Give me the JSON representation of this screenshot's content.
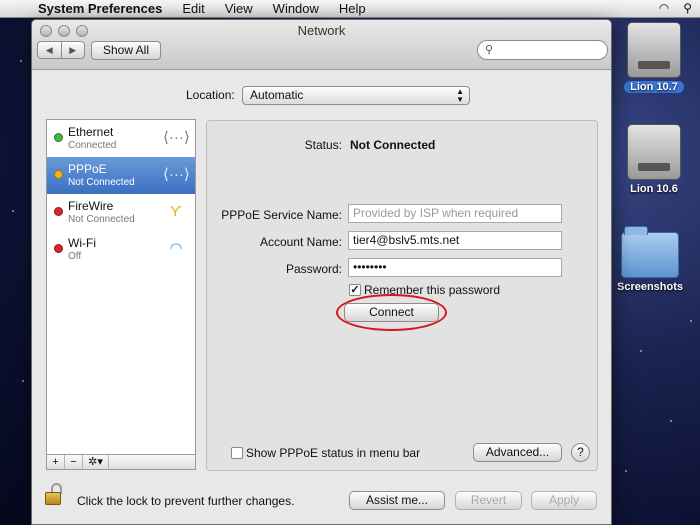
{
  "menubar": {
    "app_name": "System Preferences",
    "menus": [
      "Edit",
      "View",
      "Window",
      "Help"
    ]
  },
  "desktop": {
    "icons": [
      {
        "label": "Lion 10.7",
        "kind": "disk"
      },
      {
        "label": "Lion 10.6",
        "kind": "disk"
      },
      {
        "label": "Screenshots",
        "kind": "folder"
      }
    ]
  },
  "window": {
    "title": "Network",
    "show_all_label": "Show All",
    "search_placeholder": ""
  },
  "location": {
    "label": "Location:",
    "value": "Automatic"
  },
  "services": [
    {
      "name": "Ethernet",
      "status": "Connected",
      "dot_color": "#3fb83f",
      "icon": "ethernet-icon",
      "glyph": "⟨···⟩"
    },
    {
      "name": "PPPoE",
      "status": "Not Connected",
      "dot_color": "#f2b51c",
      "icon": "pppoe-icon",
      "glyph": "⟨···⟩"
    },
    {
      "name": "FireWire",
      "status": "Not Connected",
      "dot_color": "#d8262a",
      "icon": "firewire-icon",
      "glyph": "Ƴ"
    },
    {
      "name": "Wi-Fi",
      "status": "Off",
      "dot_color": "#d8262a",
      "icon": "wifi-icon",
      "glyph": "◠"
    }
  ],
  "list_tools": {
    "add": "+",
    "remove": "−",
    "gear": "✲▾"
  },
  "detail": {
    "status_label": "Status:",
    "status_value": "Not Connected",
    "service_name_label": "PPPoE Service Name:",
    "service_name_placeholder": "Provided by ISP when required",
    "account_label": "Account Name:",
    "account_value": "tier4@bslv5.mts.net",
    "password_label": "Password:",
    "password_value": "••••••••",
    "remember_label": "Remember this password",
    "remember_checked": "✓",
    "connect_label": "Connect",
    "show_status_label": "Show PPPoE status in menu bar",
    "advanced_label": "Advanced...",
    "help_label": "?"
  },
  "footer": {
    "lock_text": "Click the lock to prevent further changes.",
    "assist_label": "Assist me...",
    "revert_label": "Revert",
    "apply_label": "Apply"
  },
  "colors": {
    "highlight_ring": "#d8141c",
    "selection": "#3a6fc2"
  }
}
